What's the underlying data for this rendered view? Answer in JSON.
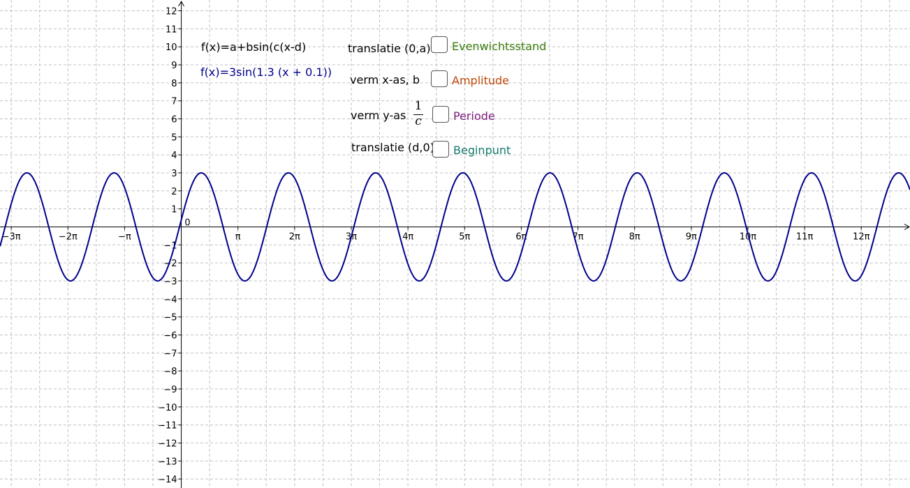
{
  "formula_general": "f(x)=a+bsin(c(x-d)",
  "formula_specific": "f(x)=3sin(1.3 (x + 0.1))",
  "controls": [
    {
      "label": "translatie (0,a)",
      "checkbox_label": "Evenwichtsstand",
      "color": "#3a7d0a",
      "checked": false
    },
    {
      "label": "verm x-as, b",
      "checkbox_label": "Amplitude",
      "color": "#c0480a",
      "checked": false
    },
    {
      "label": "verm y-as",
      "checkbox_label": "Periode",
      "color": "#7a1a7a",
      "checked": false
    },
    {
      "label": "translatie (d,0)",
      "checkbox_label": "Beginpunt",
      "color": "#147a6e",
      "checked": false
    }
  ],
  "fraction": {
    "numerator": "1",
    "denominator": "c"
  },
  "colors": {
    "curve": "#00008b",
    "grid": "#c0c0c0",
    "axis": "#000000"
  },
  "chart_data": {
    "type": "line",
    "function": "3*sin(1.3*(x+0.1))",
    "series": [
      {
        "amplitude": 3,
        "frequency": 1.3,
        "phase_shift": 0.1,
        "offset": 0,
        "color": "#00008b"
      }
    ],
    "xlim": [
      -10.05,
      40.4
    ],
    "ylim": [
      -14.5,
      12.6
    ],
    "x_ticks": [
      {
        "value": -3,
        "label": "−3π"
      },
      {
        "value": -2,
        "label": "−2π"
      },
      {
        "value": -1,
        "label": "−π"
      },
      {
        "value": 0,
        "label": "0"
      },
      {
        "value": 1,
        "label": "π"
      },
      {
        "value": 2,
        "label": "2π"
      },
      {
        "value": 3,
        "label": "3π"
      },
      {
        "value": 4,
        "label": "4π"
      },
      {
        "value": 5,
        "label": "5π"
      },
      {
        "value": 6,
        "label": "6π"
      },
      {
        "value": 7,
        "label": "7π"
      },
      {
        "value": 8,
        "label": "8π"
      },
      {
        "value": 9,
        "label": "9π"
      },
      {
        "value": 10,
        "label": "10π"
      },
      {
        "value": 11,
        "label": "11π"
      },
      {
        "value": 12,
        "label": "12π"
      }
    ],
    "y_tick_labels": [
      "12",
      "11",
      "10",
      "9",
      "8",
      "7",
      "6",
      "5",
      "4",
      "3",
      "2",
      "1",
      "0",
      "−1",
      "−2",
      "−3",
      "−4",
      "−5",
      "−6",
      "−7",
      "−8",
      "−9",
      "−10",
      "−11",
      "−12",
      "−13",
      "−14"
    ],
    "grid": true,
    "grid_style": "dashed"
  }
}
